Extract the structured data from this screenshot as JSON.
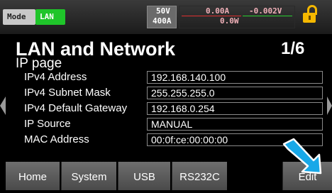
{
  "status": {
    "mode_label": "Mode",
    "interface_badge": "LAN",
    "voltage_limit": "50V",
    "current_limit": "400A",
    "current_reading": "0.00A",
    "current_reading_2": "-0.002V",
    "power_reading": "0.0W"
  },
  "page": {
    "title": "LAN and Network",
    "subtitle": "IP page",
    "page_number": "1/6"
  },
  "settings": [
    {
      "label": "IPv4 Address",
      "value": "192.168.140.100"
    },
    {
      "label": "IPv4 Subnet Mask",
      "value": "255.255.255.0"
    },
    {
      "label": "IPv4 Default Gateway",
      "value": "192.168.0.254"
    },
    {
      "label": "IP Source",
      "value": "MANUAL"
    },
    {
      "label": "MAC Address",
      "value": "00:0f:ce:00:00:00"
    }
  ],
  "softkeys": {
    "home": "Home",
    "system": "System",
    "usb": "USB",
    "rs232c": "RS232C",
    "edit": "Edit"
  },
  "colors": {
    "lan_badge": "#1fc52a",
    "lock": "#f5b800",
    "cursor_arrow": "#18a8e8"
  }
}
